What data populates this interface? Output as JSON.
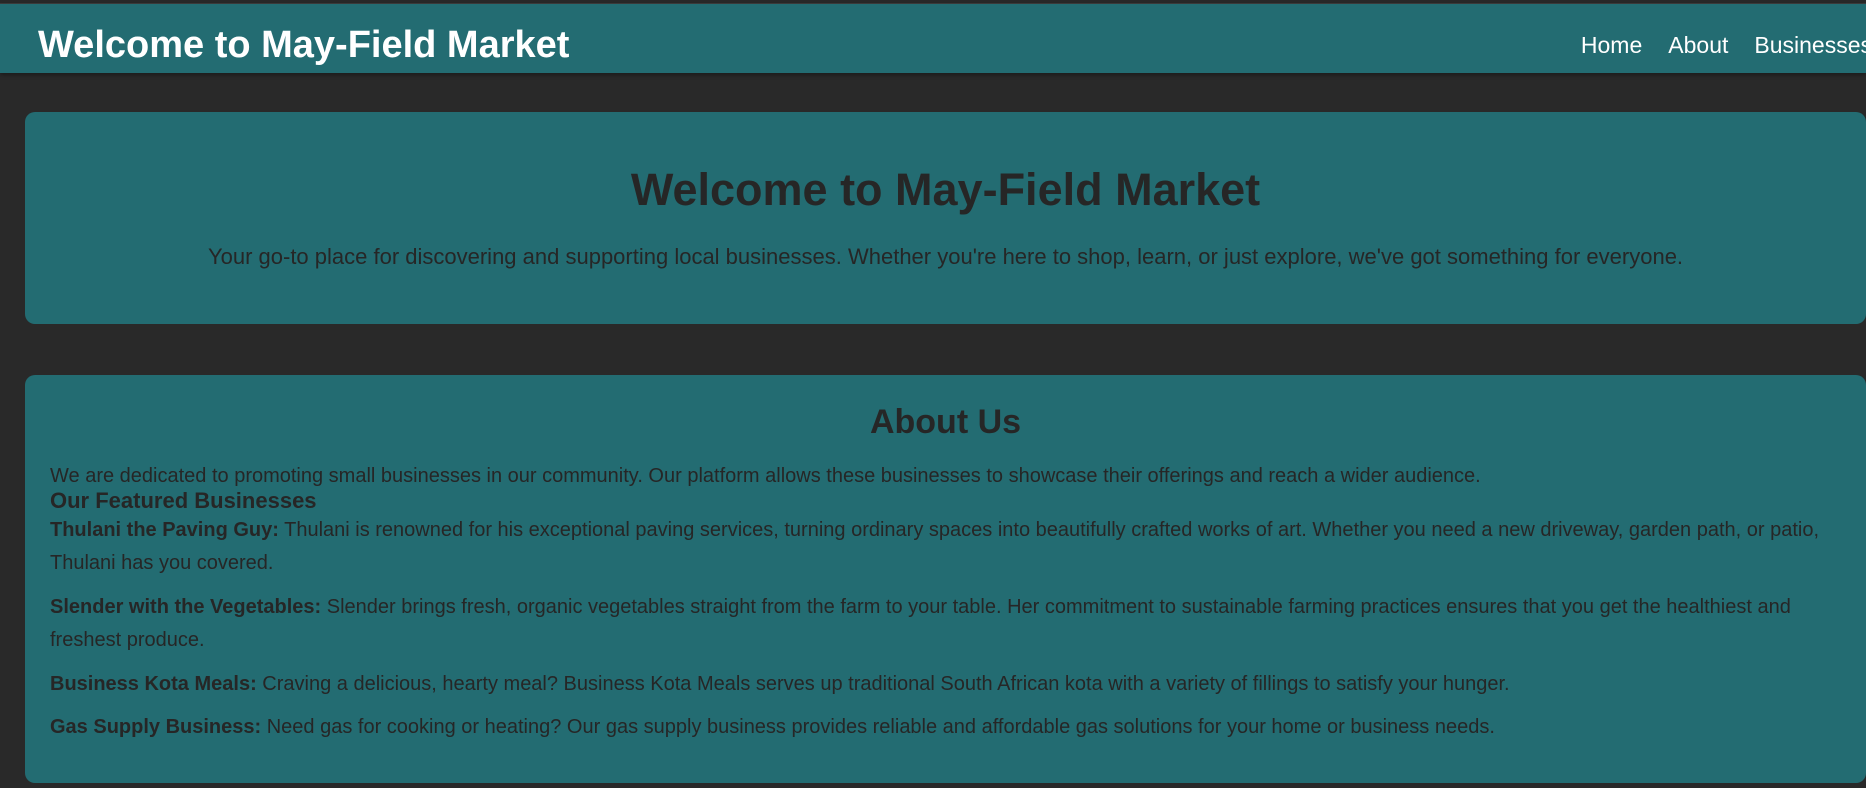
{
  "header": {
    "title": "Welcome to May-Field Market",
    "nav": [
      "Home",
      "About",
      "Businesses"
    ]
  },
  "hero": {
    "heading": "Welcome to May-Field Market",
    "tagline": "Your go-to place for discovering and supporting local businesses. Whether you're here to shop, learn, or just explore, we've got something for everyone."
  },
  "about": {
    "heading": "About Us",
    "intro": "We are dedicated to promoting small businesses in our community. Our platform allows these businesses to showcase their offerings and reach a wider audience.",
    "featured_heading": "Our Featured Businesses",
    "businesses": [
      {
        "name": "Thulani the Paving Guy:",
        "description": "Thulani is renowned for his exceptional paving services, turning ordinary spaces into beautifully crafted works of art. Whether you need a new driveway, garden path, or patio, Thulani has you covered."
      },
      {
        "name": "Slender with the Vegetables:",
        "description": "Slender brings fresh, organic vegetables straight from the farm to your table. Her commitment to sustainable farming practices ensures that you get the healthiest and freshest produce."
      },
      {
        "name": "Business Kota Meals:",
        "description": "Craving a delicious, hearty meal? Business Kota Meals serves up traditional South African kota with a variety of fillings to satisfy your hunger."
      },
      {
        "name": "Gas Supply Business:",
        "description": "Need gas for cooking or heating? Our gas supply business provides reliable and affordable gas solutions for your home or business needs."
      }
    ]
  },
  "colors": {
    "page_background": "#292929",
    "panel": "#236c72",
    "heading_text": "#262626",
    "nav_text": "#ffffff"
  }
}
